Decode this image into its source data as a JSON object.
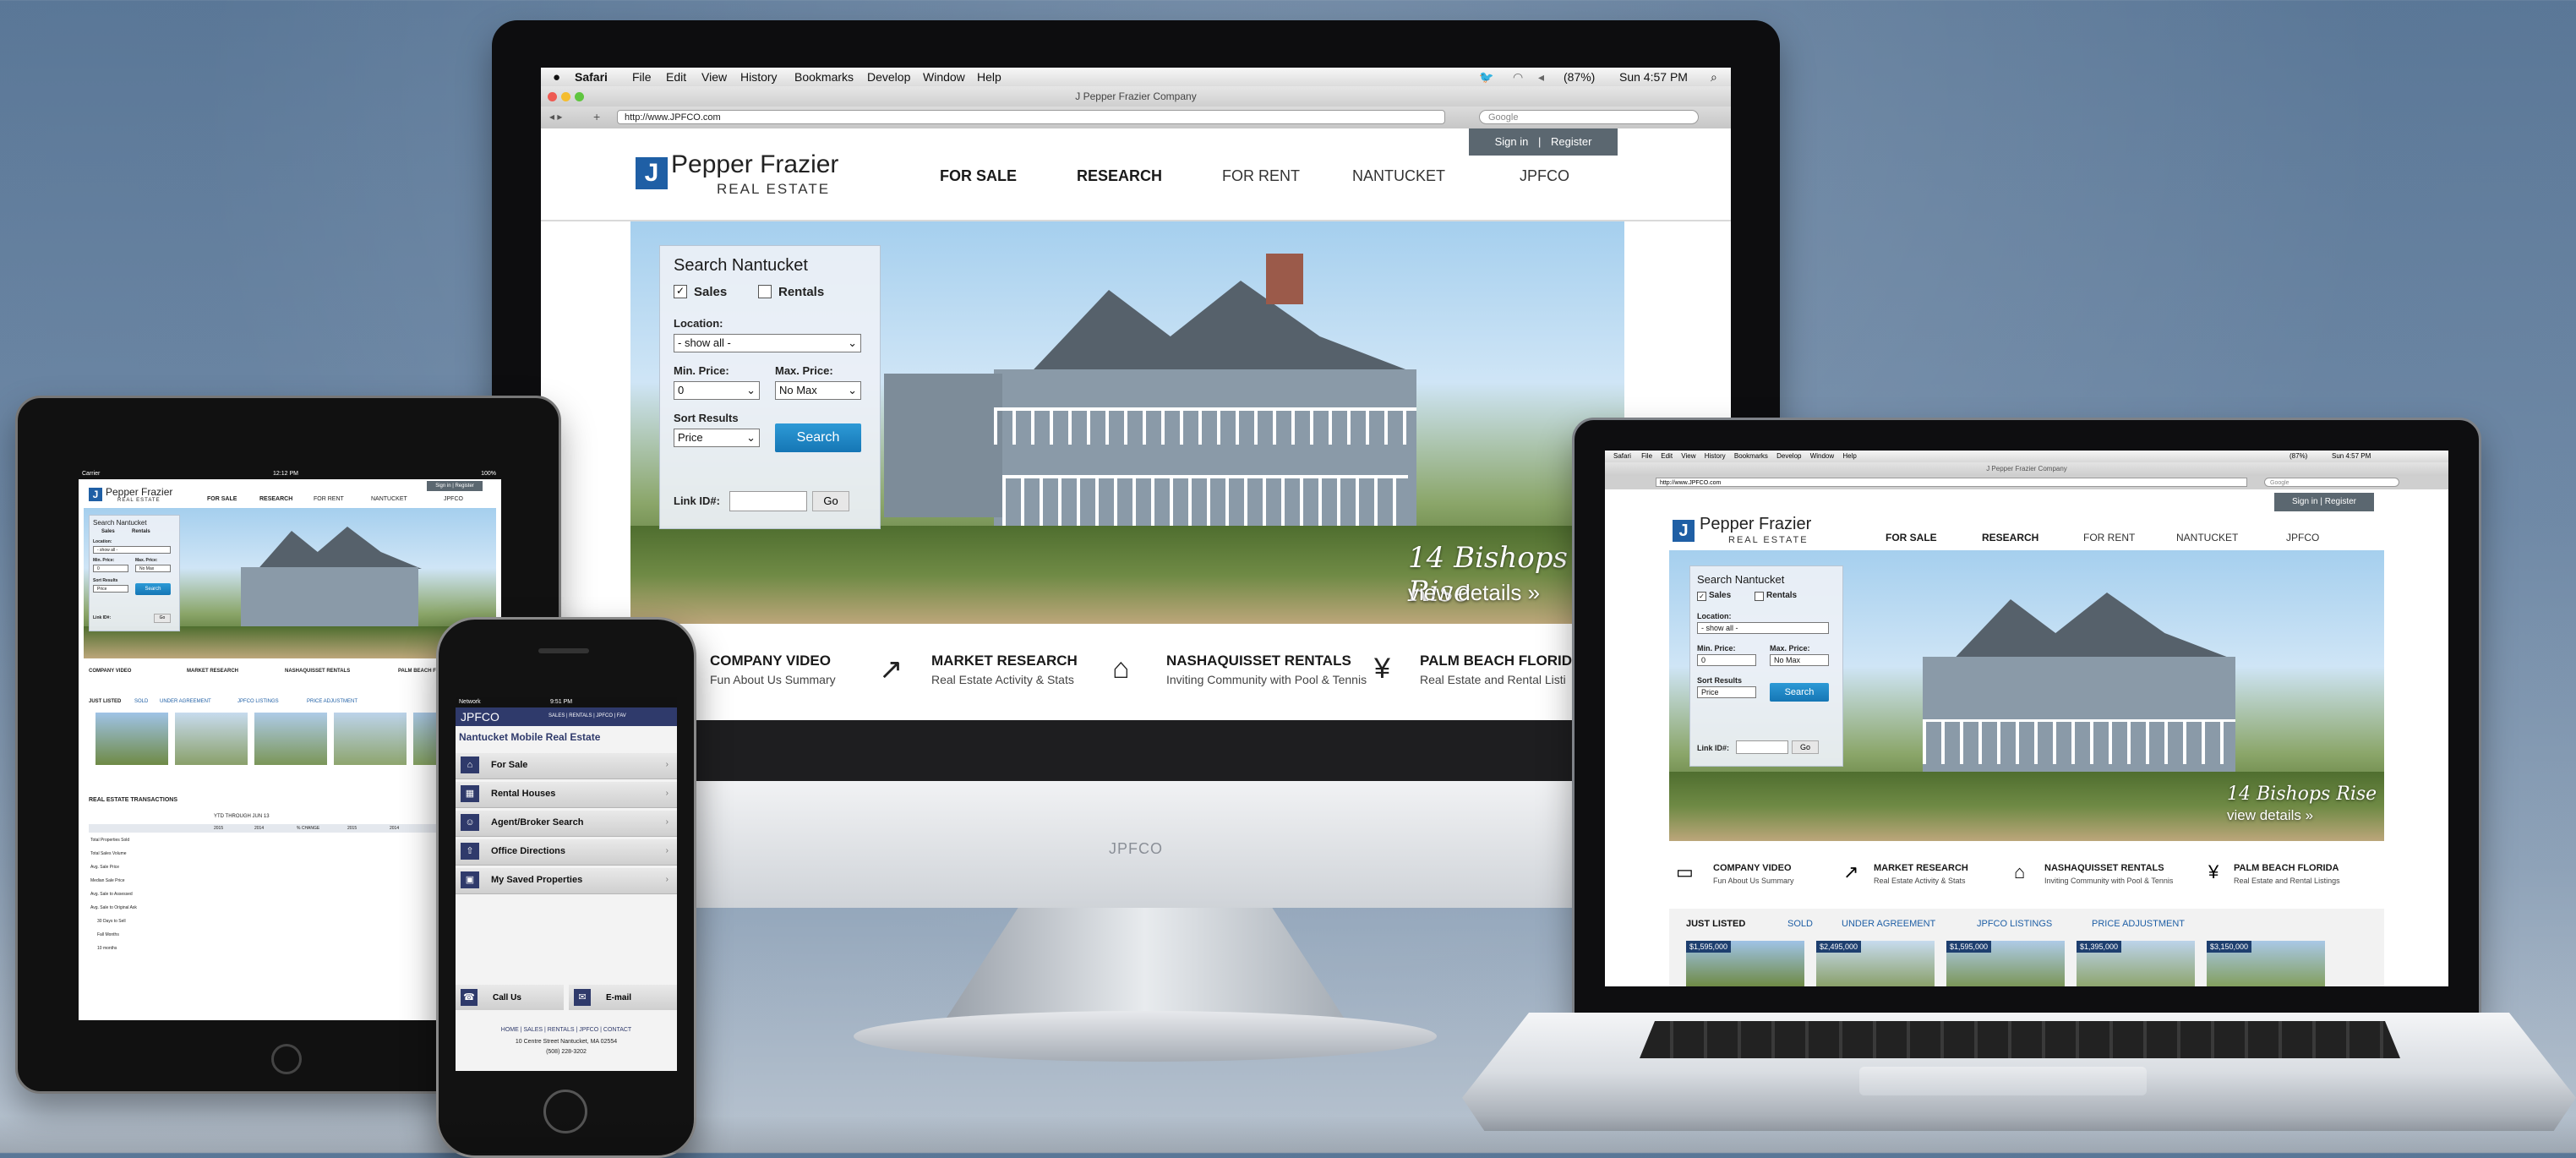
{
  "colors": {
    "brand_blue": "#1f5fa5",
    "search_button": "#1e86c6",
    "phone_header": "#2f3a6b",
    "signin_bg": "#5b6770"
  },
  "desktop": {
    "menubar": {
      "apple": "",
      "app": "Safari",
      "items": [
        "File",
        "Edit",
        "View",
        "History",
        "Bookmarks",
        "Develop",
        "Window",
        "Help"
      ],
      "battery": "(87%)",
      "clock": "Sun 4:57 PM"
    },
    "window_title": "J Pepper Frazier Company",
    "url": "http://www.JPFCO.com",
    "search_placeholder": "Google",
    "signin": "Sign in",
    "separator": "|",
    "register": "Register",
    "logo": {
      "mark": "J",
      "name": "Pepper Frazier",
      "sub": "REAL ESTATE"
    },
    "nav": [
      "FOR SALE",
      "RESEARCH",
      "FOR RENT",
      "NANTUCKET",
      "JPFCO"
    ],
    "search": {
      "title": "Search Nantucket",
      "sales": "Sales",
      "rentals": "Rentals",
      "location_label": "Location:",
      "location_value": "- show all -",
      "min_label": "Min. Price:",
      "min_value": "0",
      "max_label": "Max. Price:",
      "max_value": "No Max",
      "sort_label": "Sort Results",
      "sort_value": "Price",
      "button": "Search",
      "link_label": "Link ID#:",
      "go": "Go"
    },
    "hero_caption": "14 Bishops Rise",
    "hero_link": "view details »",
    "features": [
      {
        "icon": "video-icon",
        "title": "COMPANY VIDEO",
        "sub": "Fun About Us Summary"
      },
      {
        "icon": "chart-icon",
        "title": "MARKET RESEARCH",
        "sub": "Real Estate Activity & Stats"
      },
      {
        "icon": "map-icon",
        "title": "NASHAQUISSET RENTALS",
        "sub": "Inviting Community with Pool & Tennis"
      },
      {
        "icon": "palm-icon",
        "title": "PALM BEACH FLORIDA",
        "sub": "Real Estate and Rental Listi"
      }
    ],
    "monitor_brand": "JPFCO"
  },
  "laptop": {
    "features": [
      {
        "title": "COMPANY VIDEO",
        "sub": "Fun About Us Summary"
      },
      {
        "title": "MARKET RESEARCH",
        "sub": "Real Estate Activity & Stats"
      },
      {
        "title": "NASHAQUISSET RENTALS",
        "sub": "Inviting Community with Pool & Tennis"
      },
      {
        "title": "PALM BEACH FLORIDA",
        "sub": "Real Estate and Rental Listings"
      }
    ],
    "tabs": [
      "JUST LISTED",
      "SOLD",
      "UNDER AGREEMENT",
      "JPFCO LISTINGS",
      "PRICE ADJUSTMENT"
    ],
    "prices": [
      "$1,595,000",
      "$2,495,000",
      "$1,595,000",
      "$1,395,000",
      "$3,150,000"
    ]
  },
  "tablet": {
    "status_left": "Carrier",
    "status_time": "12:12 PM",
    "status_right": "100%",
    "tabs": [
      "JUST LISTED",
      "SOLD",
      "UNDER AGREEMENT",
      "JPFCO LISTINGS",
      "PRICE ADJUSTMENT"
    ],
    "transactions_title": "REAL ESTATE TRANSACTIONS",
    "table_header": [
      "",
      "2015",
      "2014",
      "% CHANGE",
      "2015",
      "2014"
    ],
    "ytd_label": "YTD THROUGH JUN 13",
    "rows": [
      "Total Properties Sold",
      "Total Sales Volume",
      "Avg. Sale Price",
      "Median Sale Price",
      "Avg. Sale to Assessed",
      "Avg. Sale to Original Ask",
      "30 Days to Sell",
      "Fall Months",
      "10 months"
    ]
  },
  "phone": {
    "status_left": "Network",
    "status_time": "9:51 PM",
    "brand": "JPFCO",
    "header_links": "SALES | RENTALS | JPFCO | FAV",
    "title": "Nantucket Mobile Real Estate",
    "items": [
      {
        "icon": "house-icon",
        "label": "For Sale"
      },
      {
        "icon": "rental-icon",
        "label": "Rental Houses"
      },
      {
        "icon": "agent-icon",
        "label": "Agent/Broker Search"
      },
      {
        "icon": "directions-icon",
        "label": "Office Directions"
      },
      {
        "icon": "car-icon",
        "label": "My Saved Properties"
      }
    ],
    "call": "Call Us",
    "email": "E-mail",
    "footer_links": "HOME | SALES | RENTALS | JPFCO | CONTACT",
    "address": "10 Centre Street Nantucket, MA 02554",
    "phone_number": "(508) 228-3202"
  }
}
